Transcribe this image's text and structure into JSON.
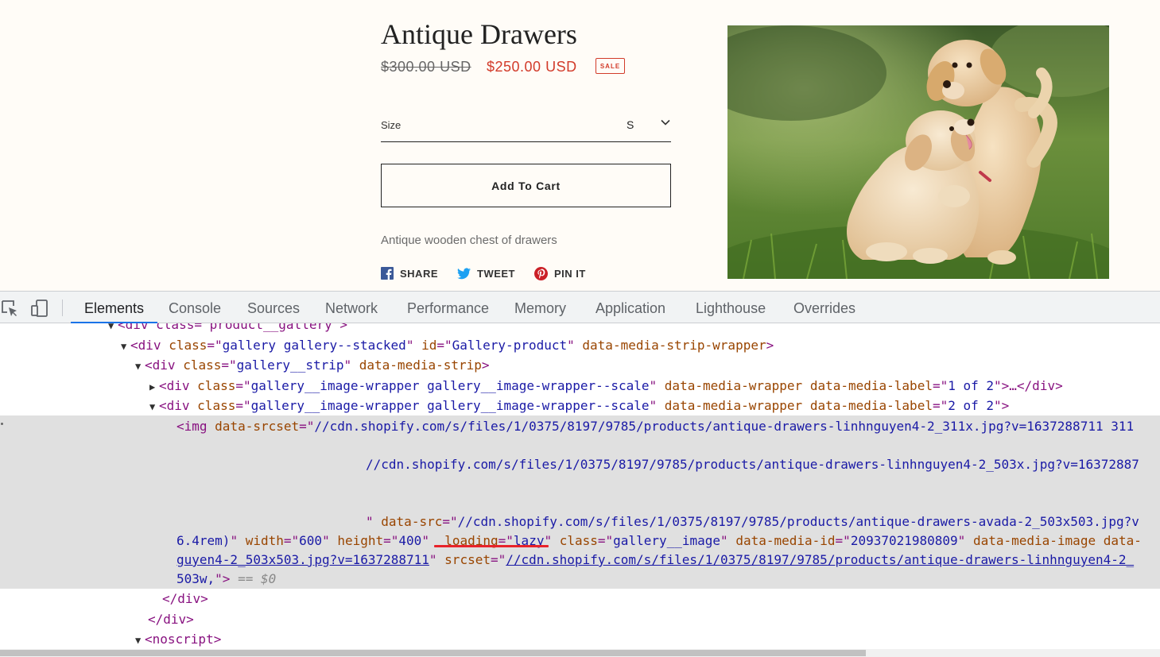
{
  "product": {
    "title": "Antique Drawers",
    "price_original": "$300.00 USD",
    "price_sale": "$250.00 USD",
    "sale_badge": "SALE",
    "size_label": "Size",
    "size_value": "S",
    "add_to_cart": "Add To Cart",
    "description": "Antique wooden chest of drawers",
    "share": {
      "facebook": "SHARE",
      "twitter": "TWEET",
      "pinterest": "PIN IT"
    },
    "image_alt": "Two golden retriever puppies on grass"
  },
  "colors": {
    "sale": "#d23b2a",
    "store_bg": "#fffcf7",
    "devtools_accent": "#1a73e8",
    "facebook": "#3b5998",
    "twitter": "#1da1f2",
    "pinterest": "#cb2027"
  },
  "devtools": {
    "tabs": [
      "Elements",
      "Console",
      "Sources",
      "Network",
      "Performance",
      "Memory",
      "Application",
      "Lighthouse",
      "Overrides"
    ],
    "active_tab": "Elements",
    "code": {
      "l0": "<div class=\"product__gallery\">",
      "l1_tag": "div",
      "l1_class": "gallery gallery--stacked",
      "l1_id": "Gallery-product",
      "l1_attr": "data-media-strip-wrapper",
      "l2_tag": "div",
      "l2_class": "gallery__strip",
      "l2_attr": "data-media-strip",
      "l3_class": "gallery__image-wrapper gallery__image-wrapper--scale",
      "l3_attr": "data-media-wrapper",
      "l3_label_attr": "data-media-label",
      "l3_label": "1 of 2",
      "l3_tail": "…</div>",
      "l4_class": "gallery__image-wrapper gallery__image-wrapper--scale",
      "l4_attr": "data-media-wrapper",
      "l4_label_attr": "data-media-label",
      "l4_label": "2 of 2",
      "img_srcset1": "//cdn.shopify.com/s/files/1/0375/8197/9785/products/antique-drawers-linhnguyen4-2_311x.jpg?v=1637288711 311",
      "img_srcset2": "//cdn.shopify.com/s/files/1/0375/8197/9785/products/antique-drawers-linhnguyen4-2_503x.jpg?v=16372887",
      "img_datasrc": "//cdn.shopify.com/s/files/1/0375/8197/9785/products/antique-drawers-avada-2_503x503.jpg?v",
      "img_sizes_tail": "6.4rem)",
      "width": "600",
      "height": "400",
      "loading": "lazy",
      "img_class": "gallery__image",
      "media_id": "20937021980809",
      "img_attr_tail": "data-media-image data-",
      "src_tail": "guyen4-2_503x503.jpg?v=1637288711",
      "srcset_val": "//cdn.shopify.com/s/files/1/0375/8197/9785/products/antique-drawers-linhnguyen4-2_",
      "srcset_tail": "503w,",
      "eq": "== $0",
      "close_div": "</div>",
      "noscript": "<noscript>"
    }
  }
}
